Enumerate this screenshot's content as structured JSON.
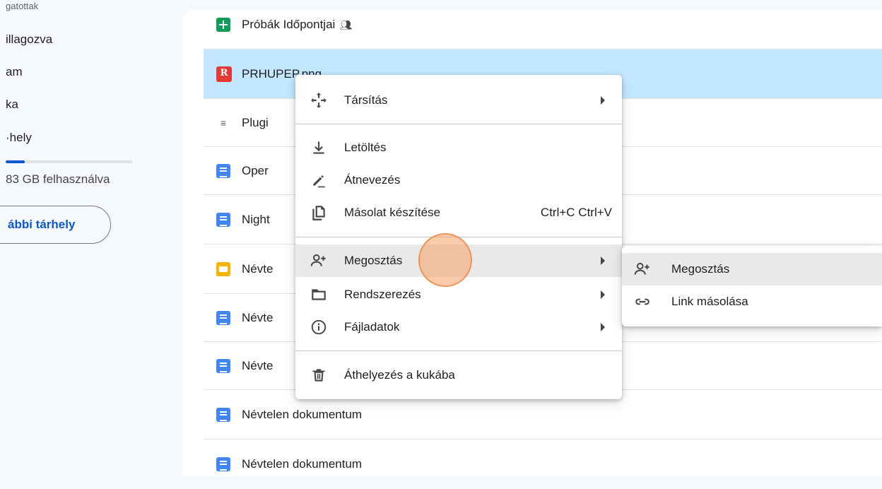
{
  "sidebar": {
    "items": [
      {
        "label": "gatottak"
      },
      {
        "label": "illagozva"
      },
      {
        "label": "am"
      },
      {
        "label": "ka"
      },
      {
        "label": "·hely"
      }
    ],
    "storage_used_fraction": 0.15,
    "storage_text": "83 GB felhasználva",
    "more_storage_label": "ábbi tárhely"
  },
  "files": [
    {
      "name": "Próbák Időpontjai",
      "type": "sheet",
      "shared": true
    },
    {
      "name": "PRHUPEP.png",
      "type": "png",
      "icon_letter": "R",
      "selected": true
    },
    {
      "name": "Plugi",
      "type": "text"
    },
    {
      "name": "Oper",
      "type": "doc"
    },
    {
      "name": "Night",
      "type": "doc"
    },
    {
      "name": "Névte",
      "type": "slides"
    },
    {
      "name": "Névte",
      "type": "doc"
    },
    {
      "name": "Névte",
      "type": "doc"
    },
    {
      "name": "Névtelen dokumentum",
      "type": "doc"
    },
    {
      "name": "Névtelen dokumentum",
      "type": "doc"
    }
  ],
  "context_menu": {
    "items": [
      {
        "label": "Társítás",
        "icon": "move-arrows-icon",
        "submenu": true
      },
      {
        "label": "Letöltés",
        "icon": "download-icon"
      },
      {
        "label": "Átnevezés",
        "icon": "rename-pencil-icon"
      },
      {
        "label": "Másolat készítése",
        "icon": "copy-icon",
        "shortcut": "Ctrl+C Ctrl+V"
      },
      {
        "label": "Megosztás",
        "icon": "person-add-icon",
        "submenu": true,
        "hover": true
      },
      {
        "label": "Rendszerezés",
        "icon": "folder-icon",
        "submenu": true
      },
      {
        "label": "Fájladatok",
        "icon": "info-icon",
        "submenu": true
      },
      {
        "label": "Áthelyezés a kukába",
        "icon": "trash-icon"
      }
    ]
  },
  "share_submenu": {
    "items": [
      {
        "label": "Megosztás",
        "icon": "person-add-icon",
        "hover": true
      },
      {
        "label": "Link másolása",
        "icon": "link-icon"
      }
    ]
  },
  "colors": {
    "selected_row": "#c2e7ff",
    "accent": "#0b57d0",
    "cursor_highlight": "#f4a064"
  }
}
